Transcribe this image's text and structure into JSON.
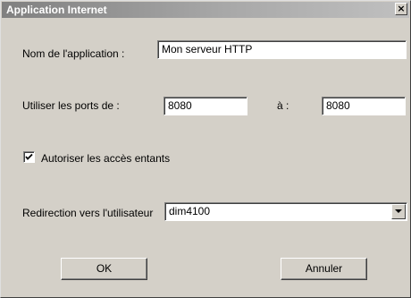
{
  "window": {
    "title": "Application Internet",
    "close_glyph": "×"
  },
  "form": {
    "app_name_label": "Nom de l'application :",
    "app_name_value": "Mon serveur HTTP",
    "ports_label": "Utiliser les ports de :",
    "port_from": "8080",
    "port_to_label": "à :",
    "port_to": "8080",
    "allow_incoming_label": "Autoriser les accès entants",
    "allow_incoming_checked": true,
    "redirect_label": "Redirection vers l'utilisateur",
    "redirect_value": "dim4100"
  },
  "buttons": {
    "ok_label": "OK",
    "cancel_label": "Annuler"
  },
  "icons": {
    "close": "close-icon",
    "check": "checkmark-icon",
    "dropdown": "chevron-down-icon"
  }
}
